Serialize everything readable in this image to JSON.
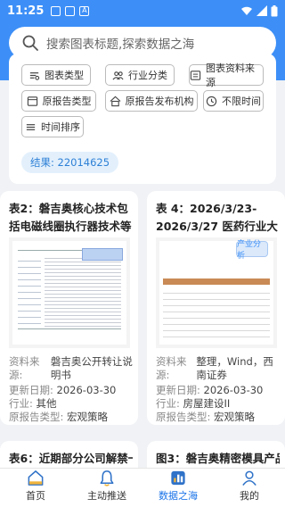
{
  "status_bar": {
    "time": "11:25",
    "icons": [
      "sim-icon",
      "notification-icon",
      "font-icon",
      "wifi-icon",
      "signal-icon",
      "battery-icon"
    ],
    "font_icon_glyph": "A"
  },
  "search": {
    "placeholder": "搜索图表标题,探索数据之海"
  },
  "filters": [
    {
      "label": "图表类型",
      "icon": "chart-type-icon"
    },
    {
      "label": "行业分类",
      "icon": "industry-icon"
    },
    {
      "label": "图表资料来源",
      "icon": "source-icon"
    },
    {
      "label": "原报告类型",
      "icon": "report-type-icon"
    },
    {
      "label": "原报告发布机构",
      "icon": "institution-icon"
    },
    {
      "label": "不限时间",
      "icon": "clock-icon"
    },
    {
      "label": "时间排序",
      "icon": "sort-icon"
    }
  ],
  "result": {
    "label": "结果: 22014625"
  },
  "cards": [
    {
      "title": "表2：磐吉奥核心技术包括电磁线圈执行器技术等",
      "badge": "",
      "source_label": "资料来源:",
      "source": "磐吉奥公开转让说明书",
      "updated_label": "更新日期:",
      "updated": "2026-03-30",
      "industry_label": "行业:",
      "industry": "其他",
      "report_type_label": "原报告类型:",
      "report_type": "宏观策略"
    },
    {
      "title": "表 4：2026/3/23-2026/3/27 医药行业大宗...",
      "badge": "产业分析",
      "source_label": "资料来源:",
      "source": "整理，Wind，西南证券",
      "updated_label": "更新日期:",
      "updated": "2026-03-30",
      "industry_label": "行业:",
      "industry": "房屋建设II",
      "report_type_label": "原报告类型:",
      "report_type": "宏观策略"
    },
    {
      "title": "表6：近期部分公司解禁一"
    },
    {
      "title": "图3：磐吉奥精密模具产品"
    }
  ],
  "nav": [
    {
      "label": "首页",
      "icon": "home-icon"
    },
    {
      "label": "主动推送",
      "icon": "bell-icon"
    },
    {
      "label": "数据之海",
      "icon": "data-sea-icon"
    },
    {
      "label": "我的",
      "icon": "profile-icon"
    }
  ],
  "colors": {
    "header": "#3d8ff7",
    "accent": "#1a73e8",
    "result_bg": "#e3f0fc",
    "badge_bg": "#dbe9fb"
  }
}
